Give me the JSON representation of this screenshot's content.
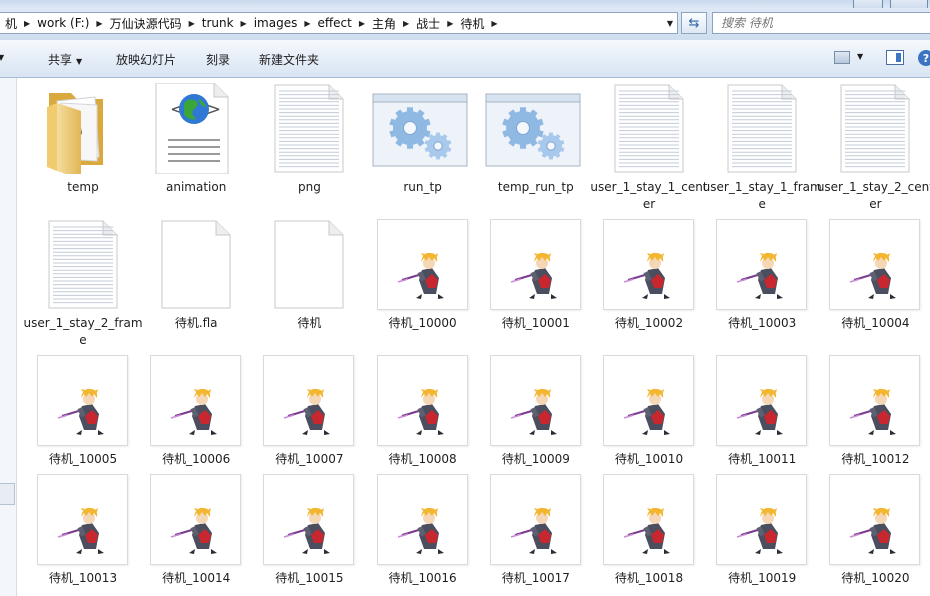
{
  "breadcrumb": [
    {
      "label": "机"
    },
    {
      "label": "work (F:)"
    },
    {
      "label": "万仙诀源代码"
    },
    {
      "label": "trunk"
    },
    {
      "label": "images"
    },
    {
      "label": "effect"
    },
    {
      "label": "主角"
    },
    {
      "label": "战士"
    },
    {
      "label": "待机"
    }
  ],
  "search": {
    "placeholder": "搜索 待机"
  },
  "toolbar": {
    "share_label": "共享",
    "slideshow_label": "放映幻灯片",
    "burn_label": "刻录",
    "new_folder_label": "新建文件夹",
    "help_label": "?"
  },
  "files": [
    {
      "name": "temp",
      "kind": "folder"
    },
    {
      "name": "animation",
      "kind": "xml"
    },
    {
      "name": "png",
      "kind": "text"
    },
    {
      "name": "run_tp",
      "kind": "app"
    },
    {
      "name": "temp_run_tp",
      "kind": "app"
    },
    {
      "name": "user_1_stay_1_center",
      "kind": "text"
    },
    {
      "name": "user_1_stay_1_frame",
      "kind": "text"
    },
    {
      "name": "user_1_stay_2_center",
      "kind": "text"
    },
    {
      "name": "user_1_stay_2_frame",
      "kind": "text"
    },
    {
      "name": "待机.fla",
      "kind": "blank"
    },
    {
      "name": "待机",
      "kind": "blank"
    },
    {
      "name": "待机_10000",
      "kind": "image"
    },
    {
      "name": "待机_10001",
      "kind": "image"
    },
    {
      "name": "待机_10002",
      "kind": "image"
    },
    {
      "name": "待机_10003",
      "kind": "image"
    },
    {
      "name": "待机_10004",
      "kind": "image"
    },
    {
      "name": "待机_10005",
      "kind": "image"
    },
    {
      "name": "待机_10006",
      "kind": "image"
    },
    {
      "name": "待机_10007",
      "kind": "image"
    },
    {
      "name": "待机_10008",
      "kind": "image"
    },
    {
      "name": "待机_10009",
      "kind": "image"
    },
    {
      "name": "待机_10010",
      "kind": "image"
    },
    {
      "name": "待机_10011",
      "kind": "image"
    },
    {
      "name": "待机_10012",
      "kind": "image"
    },
    {
      "name": "待机_10013",
      "kind": "image"
    },
    {
      "name": "待机_10014",
      "kind": "image"
    },
    {
      "name": "待机_10015",
      "kind": "image"
    },
    {
      "name": "待机_10016",
      "kind": "image"
    },
    {
      "name": "待机_10017",
      "kind": "image"
    },
    {
      "name": "待机_10018",
      "kind": "image"
    },
    {
      "name": "待机_10019",
      "kind": "image"
    },
    {
      "name": "待机_10020",
      "kind": "image"
    }
  ],
  "colors": {
    "folder": "#e9c46a",
    "selection_border": "#8ea4c1",
    "toolbar_bg": "#dfe9f5",
    "sprite_hair": "#f2b630",
    "sprite_armor": "#4a4e5e",
    "sprite_red": "#c9272f"
  }
}
